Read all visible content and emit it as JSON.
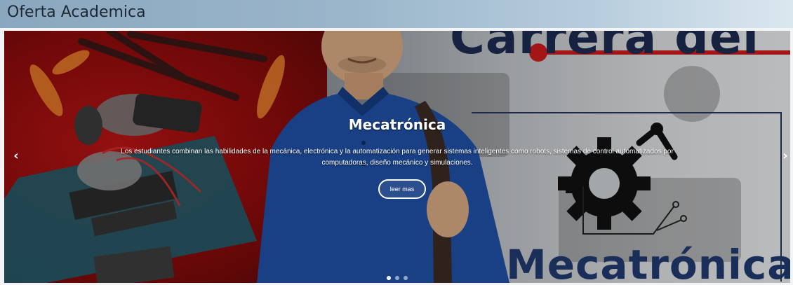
{
  "header": {
    "title": "Oferta Academica"
  },
  "slide": {
    "title": "Mecatrónica",
    "description": "Los estudiantes combinan las habilidades de la mecánica, electrónica y la automatización para generar sistemas inteligentes como robots, sistemas de control automatizados por computadoras, diseño mecánico y simulaciones.",
    "button_label": "leer mas",
    "background_text_top": "Carrera del",
    "background_text_bottom": "Mecatrónica"
  },
  "controls": {
    "prev_icon": "‹",
    "next_icon": "›",
    "indicator_count": 3,
    "active_indicator": 1
  },
  "colors": {
    "accent_red": "#c81b1b",
    "navy": "#1f3a6d",
    "shirt_blue": "#1f4fa3"
  }
}
